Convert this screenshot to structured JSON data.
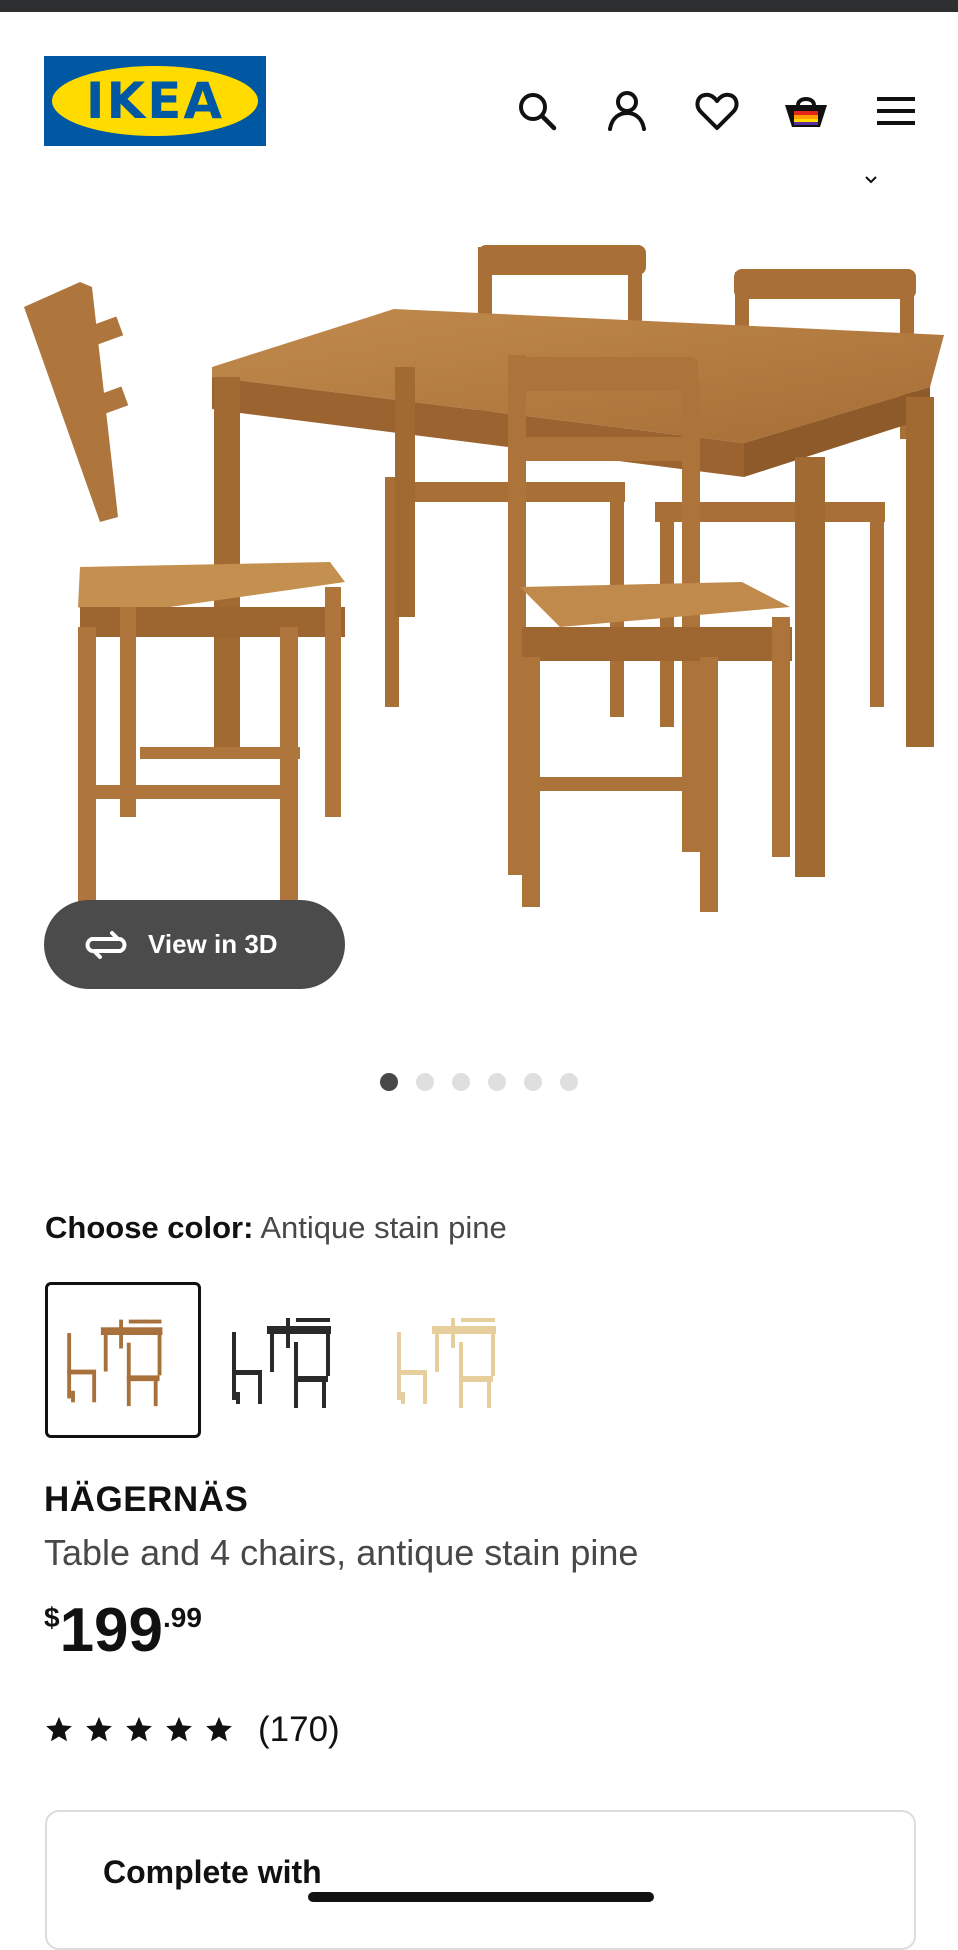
{
  "header": {
    "logo_text": "IKEA",
    "icons": [
      "search-icon",
      "account-icon",
      "heart-icon",
      "cart-icon",
      "menu-icon"
    ]
  },
  "gallery": {
    "view3d_label": "View in 3D",
    "page_count": 6,
    "active_page": 1
  },
  "color": {
    "label": "Choose color:",
    "value": "Antique stain pine",
    "swatches": [
      "Antique stain pine",
      "Black-brown",
      "Pine"
    ]
  },
  "product": {
    "name": "HÄGERNÄS",
    "description": "Table and 4 chairs, antique stain pine",
    "price_currency": "$",
    "price_int": "199",
    "price_dec": ".99",
    "rating_stars": 5,
    "review_count": "(170)"
  },
  "complete": {
    "title": "Complete with"
  },
  "colors": {
    "brand_blue": "#0058a3",
    "brand_yellow": "#ffdb00",
    "wood": "#b07a3f",
    "button_gray": "#4b4b4b"
  }
}
